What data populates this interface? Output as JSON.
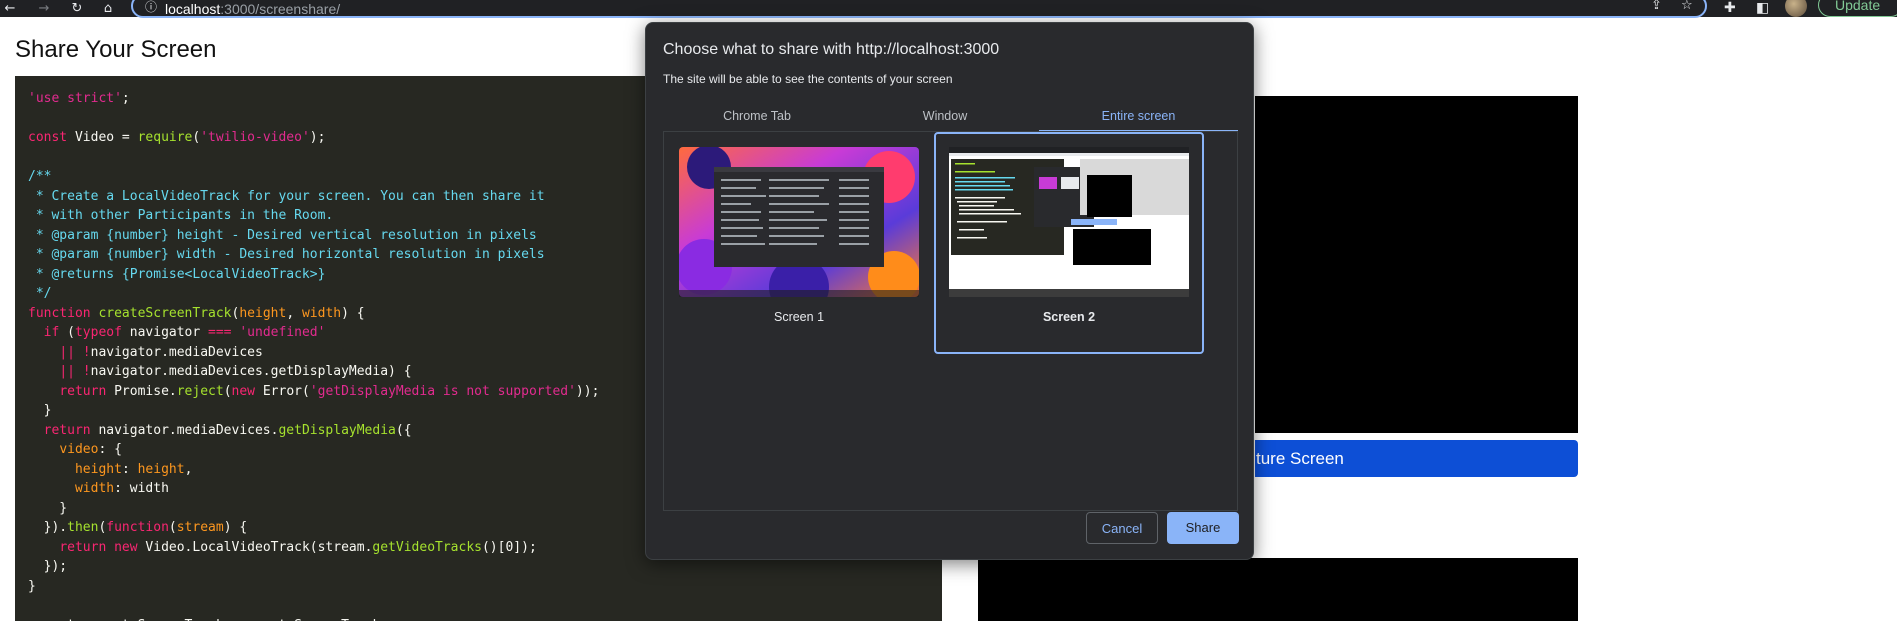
{
  "browser": {
    "url_host": "localhost",
    "url_path": ":3000/screenshare/",
    "update_label": "Update"
  },
  "page": {
    "title": "Share Your Screen",
    "capture_button_label": "ture Screen"
  },
  "code": {
    "lines": [
      "'use strict';",
      "",
      "const Video = require('twilio-video');",
      "",
      "/**",
      " * Create a LocalVideoTrack for your screen. You can then share it",
      " * with other Participants in the Room.",
      " * @param {number} height - Desired vertical resolution in pixels",
      " * @param {number} width - Desired horizontal resolution in pixels",
      " * @returns {Promise<LocalVideoTrack>}",
      " */",
      "function createScreenTrack(height, width) {",
      "  if (typeof navigator === 'undefined'",
      "    || !navigator.mediaDevices",
      "    || !navigator.mediaDevices.getDisplayMedia) {",
      "    return Promise.reject(new Error('getDisplayMedia is not supported'));",
      "  }",
      "  return navigator.mediaDevices.getDisplayMedia({",
      "    video: {",
      "      height: height,",
      "      width: width",
      "    }",
      "  }).then(function(stream) {",
      "    return new Video.LocalVideoTrack(stream.getVideoTracks()[0]);",
      "  });",
      "}",
      "",
      "exports.createScreenTrack = createScreenTrack;"
    ]
  },
  "dialog": {
    "title": "Choose what to share with http://localhost:3000",
    "subtitle": "The site will be able to see the contents of your screen",
    "tabs": [
      {
        "label": "Chrome Tab"
      },
      {
        "label": "Window"
      },
      {
        "label": "Entire screen"
      }
    ],
    "active_tab": "Entire screen",
    "screens": [
      {
        "label": "Screen 1"
      },
      {
        "label": "Screen 2",
        "selected": true
      }
    ],
    "cancel_label": "Cancel",
    "share_label": "Share"
  }
}
